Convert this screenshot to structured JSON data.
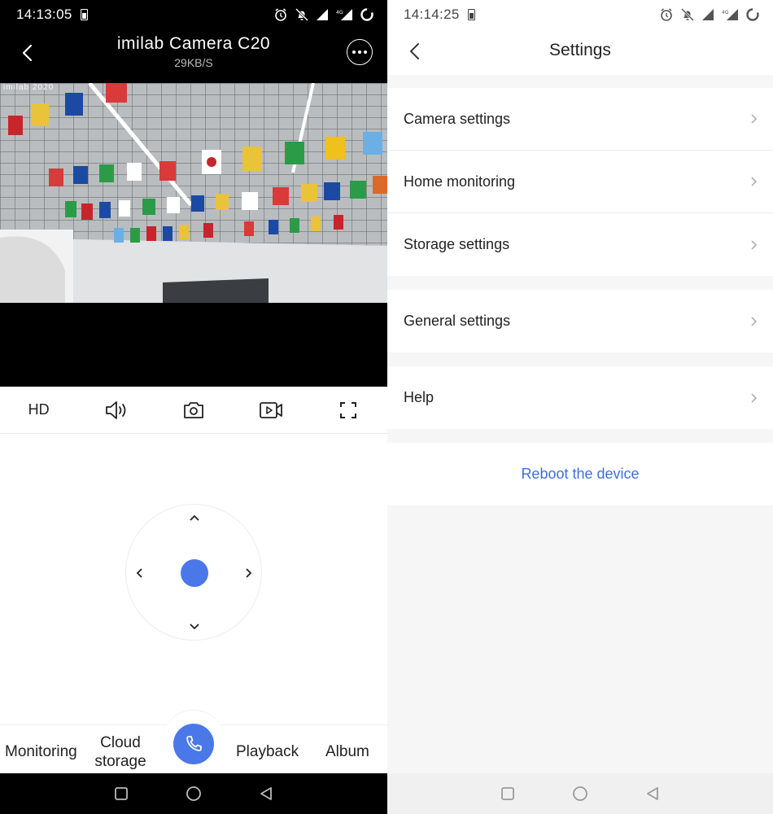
{
  "left": {
    "status": {
      "time": "14:13:05"
    },
    "header": {
      "title": "imilab Camera C20",
      "speed": "29KB/S"
    },
    "video": {
      "osd": "imilab 2020"
    },
    "controls": {
      "hd_label": "HD"
    },
    "tabs": {
      "monitoring": "Monitoring",
      "cloud_line1": "Cloud",
      "cloud_line2": "storage",
      "playback": "Playback",
      "album": "Album"
    },
    "colors": {
      "accent": "#4a78e8"
    }
  },
  "right": {
    "status": {
      "time": "14:14:25"
    },
    "header": {
      "title": "Settings"
    },
    "items": {
      "camera": "Camera settings",
      "home": "Home monitoring",
      "storage": "Storage settings",
      "general": "General settings",
      "help": "Help"
    },
    "reboot": "Reboot the device",
    "colors": {
      "link": "#3e6fdc"
    }
  }
}
